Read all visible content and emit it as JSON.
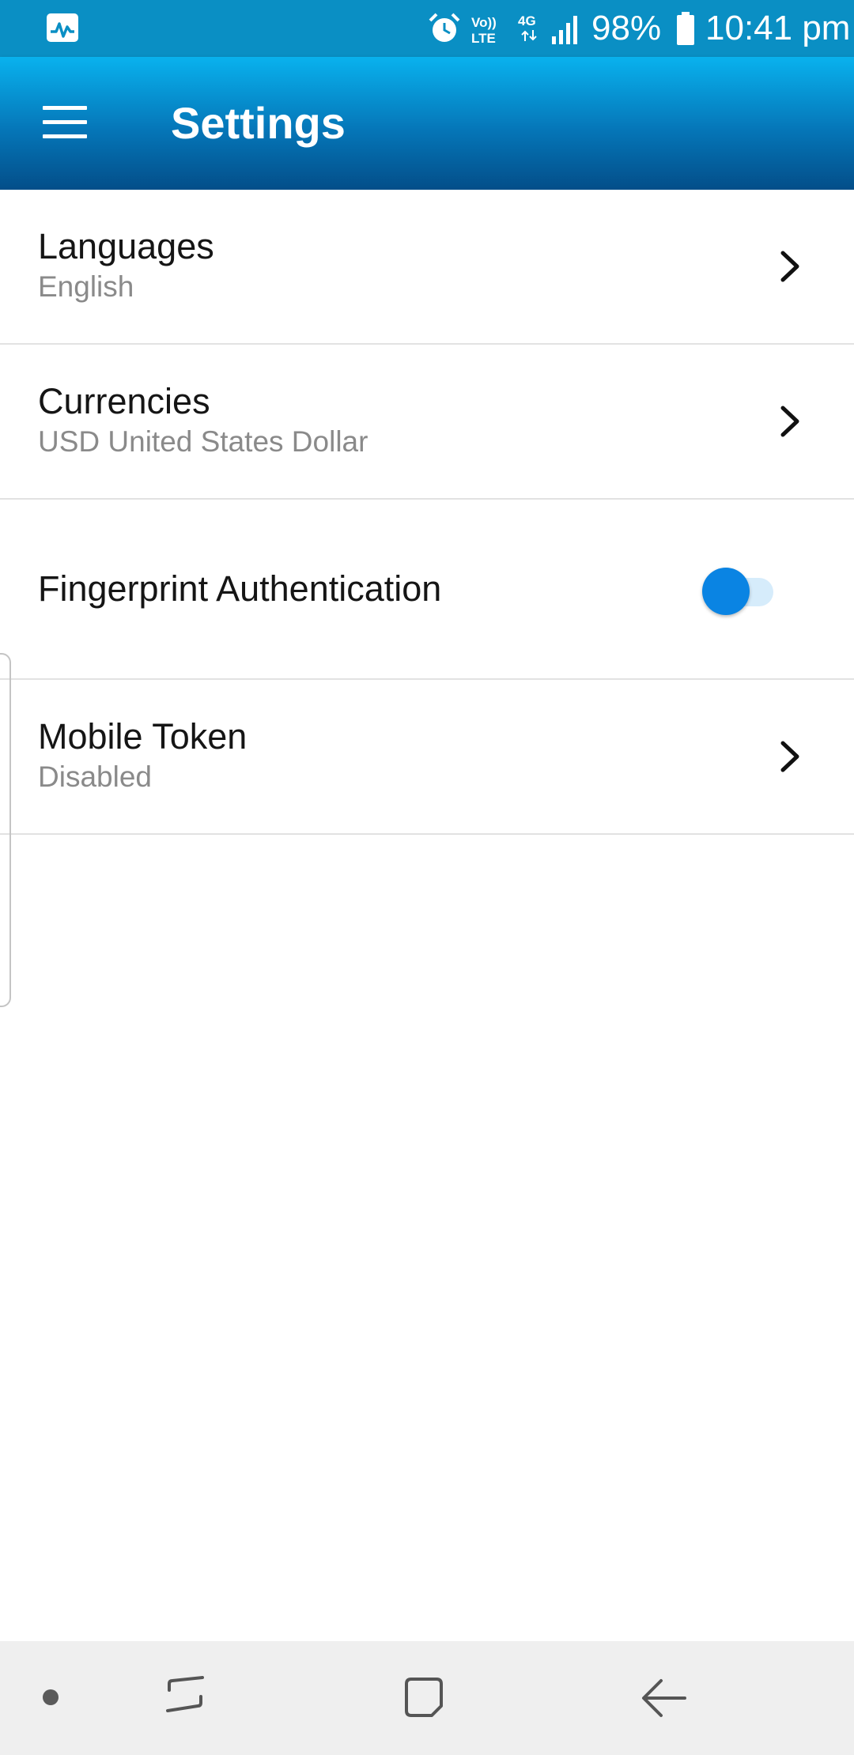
{
  "status_bar": {
    "battery_percent": "98%",
    "time": "10:41 pm",
    "network": "4G",
    "volte": "Vo)) LTE",
    "icons": [
      "activity-icon",
      "alarm-icon",
      "volte-icon",
      "network-4g-icon",
      "signal-icon",
      "battery-icon"
    ]
  },
  "app_bar": {
    "title": "Settings",
    "menu_icon": "hamburger-menu-icon"
  },
  "settings": [
    {
      "id": "languages",
      "title": "Languages",
      "value": "English",
      "control": "chevron"
    },
    {
      "id": "currencies",
      "title": "Currencies",
      "value": "USD United States Dollar",
      "control": "chevron"
    },
    {
      "id": "fingerprint",
      "title": "Fingerprint Authentication",
      "control": "toggle",
      "enabled": true
    },
    {
      "id": "mobile_token",
      "title": "Mobile Token",
      "value": "Disabled",
      "control": "chevron"
    }
  ],
  "colors": {
    "status_bar": "#0a8fc4",
    "app_bar_top": "#09b2ee",
    "app_bar_bottom": "#034e89",
    "toggle_accent": "#0a84e3",
    "divider": "#e2e2e2",
    "secondary_text": "#8a8a8a",
    "nav_bar": "#efefef"
  },
  "nav_bar": {
    "buttons": [
      "recents-icon",
      "home-icon",
      "back-icon"
    ]
  }
}
